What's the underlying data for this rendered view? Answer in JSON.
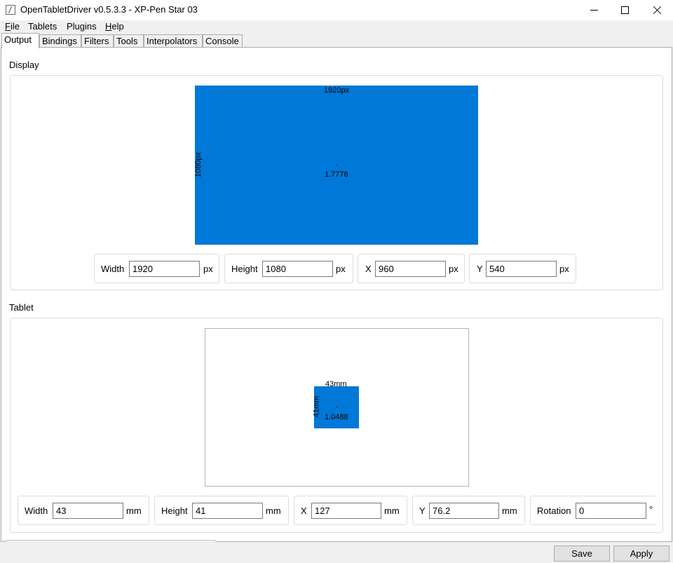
{
  "window": {
    "title": "OpenTabletDriver v0.5.3.3 - XP-Pen Star 03"
  },
  "menu": [
    "File",
    "Tablets",
    "Plugins",
    "Help"
  ],
  "tabs": [
    "Output",
    "Bindings",
    "Filters",
    "Tools",
    "Interpolators",
    "Console"
  ],
  "display": {
    "section_title": "Display",
    "area_width_label": "1920px",
    "area_height_label": "1080px",
    "aspect_label": "1.7778",
    "fields": {
      "width": {
        "label": "Width",
        "value": "1920",
        "unit": "px"
      },
      "height": {
        "label": "Height",
        "value": "1080",
        "unit": "px"
      },
      "x": {
        "label": "X",
        "value": "960",
        "unit": "px"
      },
      "y": {
        "label": "Y",
        "value": "540",
        "unit": "px"
      }
    }
  },
  "tablet": {
    "section_title": "Tablet",
    "area_width_label": "43mm",
    "area_height_label": "41mm",
    "aspect_label": "1.0488",
    "fields": {
      "width": {
        "label": "Width",
        "value": "43",
        "unit": "mm"
      },
      "height": {
        "label": "Height",
        "value": "41",
        "unit": "mm"
      },
      "x": {
        "label": "X",
        "value": "127",
        "unit": "mm"
      },
      "y": {
        "label": "Y",
        "value": "76.2",
        "unit": "mm"
      },
      "rotation": {
        "label": "Rotation",
        "value": "0",
        "unit": "°"
      }
    }
  },
  "buttons": {
    "save": "Save",
    "apply": "Apply"
  },
  "colors": {
    "area_fill": "#0078d7"
  }
}
